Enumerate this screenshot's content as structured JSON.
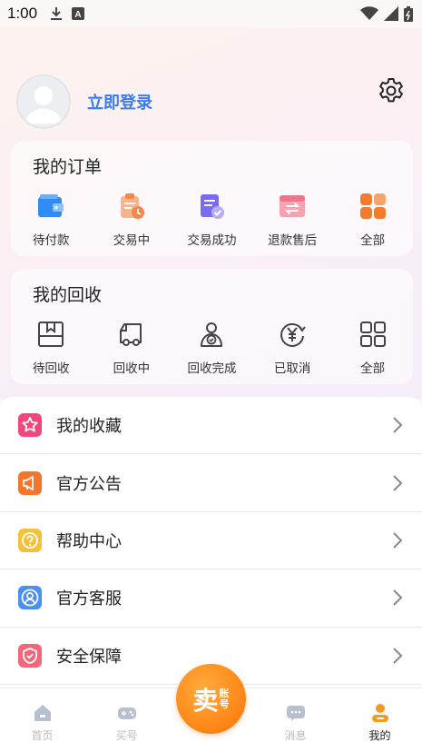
{
  "status_bar": {
    "time": "1:00",
    "icons_left": [
      "download-icon",
      "a-badge-icon"
    ],
    "icons_right": [
      "wifi-icon",
      "signal-icon",
      "battery-icon"
    ]
  },
  "profile": {
    "login_label": "立即登录",
    "avatar_icon": "avatar-placeholder-icon",
    "settings_icon": "gear-icon"
  },
  "orders": {
    "title": "我的订单",
    "items": [
      {
        "label": "待付款",
        "icon": "wallet-icon",
        "color": "#2f8cf4"
      },
      {
        "label": "交易中",
        "icon": "clipboard-clock-icon",
        "color": "#f4874a"
      },
      {
        "label": "交易成功",
        "icon": "document-check-icon",
        "color": "#7a6cf0"
      },
      {
        "label": "退款售后",
        "icon": "exchange-icon",
        "color": "#f4738a"
      },
      {
        "label": "全部",
        "icon": "grid-icon",
        "color": "#f47a2c"
      }
    ]
  },
  "recycle": {
    "title": "我的回收",
    "items": [
      {
        "label": "待回收",
        "icon": "box-icon"
      },
      {
        "label": "回收中",
        "icon": "truck-icon"
      },
      {
        "label": "回收完成",
        "icon": "person-check-icon"
      },
      {
        "label": "已取消",
        "icon": "yen-refresh-icon"
      },
      {
        "label": "全部",
        "icon": "grid-outline-icon"
      }
    ]
  },
  "menu": [
    {
      "label": "我的收藏",
      "icon": "star-icon",
      "color": "#f2477a"
    },
    {
      "label": "官方公告",
      "icon": "megaphone-icon",
      "color": "#f4762c"
    },
    {
      "label": "帮助中心",
      "icon": "question-icon",
      "color": "#f3c23a"
    },
    {
      "label": "官方客服",
      "icon": "person-icon",
      "color": "#4a90f0"
    },
    {
      "label": "安全保障",
      "icon": "shield-check-icon",
      "color": "#f2677a"
    }
  ],
  "tabbar": {
    "items": [
      {
        "label": "首页",
        "icon": "home-icon",
        "active": false
      },
      {
        "label": "买号",
        "icon": "gamepad-icon",
        "active": false
      },
      {
        "label": "",
        "icon": "sell-button",
        "active": false
      },
      {
        "label": "消息",
        "icon": "chat-icon",
        "active": false
      },
      {
        "label": "我的",
        "icon": "user-icon",
        "active": true
      }
    ],
    "sell": {
      "big": "卖",
      "small_top": "账",
      "small_bottom": "号"
    }
  }
}
